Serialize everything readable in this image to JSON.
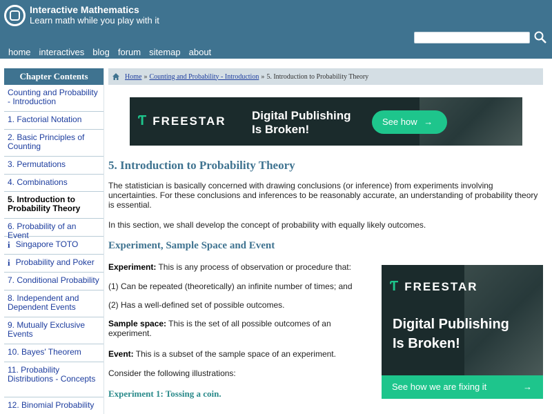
{
  "header": {
    "site_title": "Interactive Mathematics",
    "tagline": "Learn math while you play with it",
    "nav": [
      "home",
      "interactives",
      "blog",
      "forum",
      "sitemap",
      "about"
    ],
    "search_placeholder": ""
  },
  "sidebar": {
    "title": "Chapter Contents",
    "items": [
      {
        "label": "Counting and Probability - Introduction",
        "icon": ""
      },
      {
        "label": "1. Factorial Notation",
        "icon": ""
      },
      {
        "label": "2. Basic Principles of Counting",
        "icon": ""
      },
      {
        "label": "3. Permutations",
        "icon": ""
      },
      {
        "label": "4. Combinations",
        "icon": ""
      },
      {
        "label": "5. Introduction to Probability Theory",
        "icon": "",
        "active": true
      },
      {
        "label": "6. Probability of an Event",
        "icon": ""
      },
      {
        "label": "Singapore TOTO",
        "icon": "i"
      },
      {
        "label": "Probability and Poker",
        "icon": "i"
      },
      {
        "label": "7. Conditional Probability",
        "icon": ""
      },
      {
        "label": "8. Independent and Dependent Events",
        "icon": ""
      },
      {
        "label": "9. Mutually Exclusive Events",
        "icon": ""
      },
      {
        "label": "10. Bayes' Theorem",
        "icon": ""
      },
      {
        "label": "11. Probability Distributions - Concepts",
        "icon": ""
      },
      {
        "label": "12. Binomial Probability",
        "icon": ""
      }
    ]
  },
  "breadcrumb": {
    "home": "Home",
    "sep": "»",
    "section": "Counting and Probability - Introduction",
    "current": "5. Introduction to Probability Theory"
  },
  "ads": {
    "brand": "FREESTAR",
    "top_headline_1": "Digital Publishing",
    "top_headline_2": "Is Broken!",
    "top_button": "See how",
    "side_headline_1": "Digital Publishing",
    "side_headline_2": "Is Broken!",
    "side_button": "See how we are fixing it",
    "accent": "#1ec58c"
  },
  "content": {
    "title": "5. Introduction to Probability Theory",
    "intro": "The statistician is basically concerned with drawing conclusions (or inference) from experiments involving uncertainties. For these conclusions and inferences to be reasonably accurate, an understanding of probability theory is essential.",
    "intro2": "In this section, we shall develop the concept of probability with equally likely outcomes.",
    "heading2": "Experiment, Sample Space and Event",
    "experiment_term": "Experiment:",
    "experiment_def": " This is any process of observation or procedure that:",
    "point1": "(1) Can be repeated (theoretically) an infinite number of times; and",
    "point2": "(2) Has a well-defined set of possible outcomes.",
    "sample_term": "Sample space:",
    "sample_def": " This is the set of all possible outcomes of an experiment.",
    "event_term": "Event:",
    "event_def": " This is a subset of the sample space of an experiment.",
    "consider": "Consider the following illustrations:",
    "exp1": "Experiment 1: Tossing a coin."
  },
  "colors": {
    "header_bg": "#3f7390",
    "link": "#1d3d9e",
    "heading": "#3f7390"
  }
}
